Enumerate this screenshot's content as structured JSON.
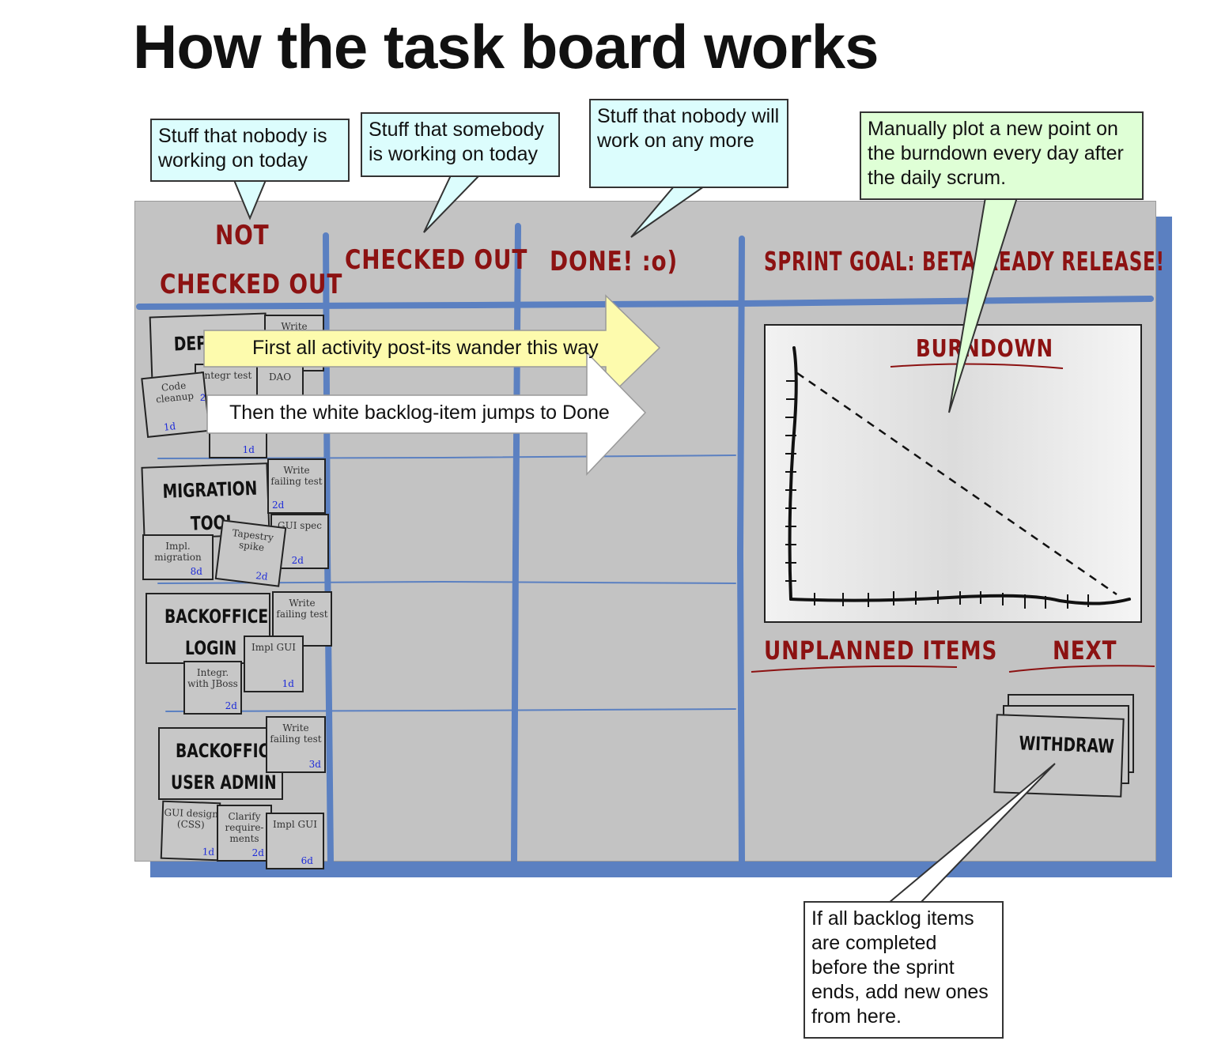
{
  "title": "How the task board works",
  "callouts": {
    "not_checked_out": "Stuff that nobody is working on today",
    "checked_out": "Stuff that somebody is working on today",
    "done": "Stuff that nobody will work on any more",
    "burndown": "Manually plot a new point on the burndown every day after the daily scrum.",
    "next": "If all backlog items are completed before the sprint ends, add new ones from here."
  },
  "columns": {
    "not_line1": "NOT",
    "not_line2": "CHECKED OUT",
    "checked_out": "CHECKED OUT",
    "done": "DONE! :o)",
    "sprint_goal": "SPRINT GOAL: BETA-READY RELEASE!"
  },
  "arrows": {
    "yellow": "First all activity post-its wander this way",
    "white": "Then the white backlog-item jumps to Done"
  },
  "sections": {
    "burndown": "BURNDOWN",
    "unplanned": "UNPLANNED ITEMS",
    "next": "NEXT",
    "withdraw": "WITHDRAW"
  },
  "stories": {
    "dep": "DEP",
    "migration_1": "MIGRATION",
    "migration_2": "TOOL",
    "backoffice_login_1": "BACKOFFICE",
    "backoffice_login_2": "LOGIN",
    "backoffice_user_1": "BACKOFFICE",
    "backoffice_user_2": "USER ADMIN"
  },
  "tasks": {
    "write_top": "Write",
    "integr_test": "Integr test",
    "dao": "DAO",
    "code_cleanup": "Code cleanup",
    "code_cleanup_est": "1d",
    "est_2": "2",
    "hidden_est": "1d",
    "write_failing_test_1": "Write failing test",
    "write_failing_test_1_est": "2d",
    "gui_spec": "GUI spec",
    "gui_spec_est": "2d",
    "tapestry_spike": "Tapestry spike",
    "tapestry_spike_est": "2d",
    "impl_migration": "Impl. migration",
    "impl_migration_est": "8d",
    "write_failing_test_2": "Write failing test",
    "impl_gui_1": "Impl GUI",
    "impl_gui_1_est": "1d",
    "integr_jboss": "Integr. with JBoss",
    "integr_jboss_est": "2d",
    "write_failing_test_3": "Write failing test",
    "write_failing_test_3_est": "3d",
    "gui_design": "GUI design (CSS)",
    "gui_design_est": "1d",
    "clarify_req": "Clarify require-ments",
    "clarify_req_est": "2d",
    "impl_gui_2": "Impl GUI",
    "impl_gui_2_est": "6d"
  },
  "colors": {
    "board": "#c3c3c3",
    "board_lines": "#5b80c1",
    "header_red": "#8c1212",
    "callout_blue": "#dcfdfd",
    "callout_green": "#dfffd6",
    "arrow_yellow": "#fdfbad",
    "estimate_blue": "#1d2bd9"
  }
}
